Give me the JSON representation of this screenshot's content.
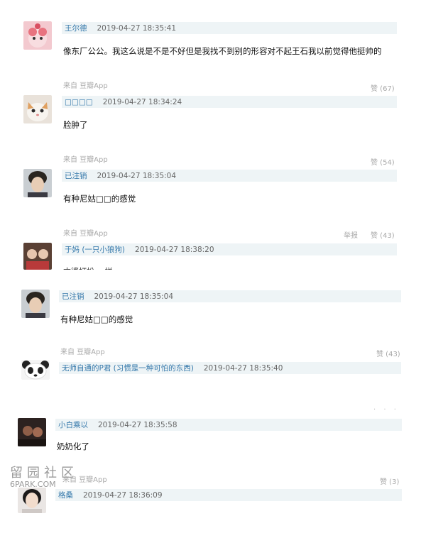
{
  "comments": [
    {
      "user": "王尔德",
      "time": "2019-04-27 18:35:41",
      "text": "像东厂公公。我这么说是不是不好但是我找不到别的形容对不起王石我以前觉得他挺帅的",
      "source": "来自 豆瓣App",
      "like": "赞 (67)"
    },
    {
      "user": "□□□□",
      "time": "2019-04-27 18:34:24",
      "text": "脸肿了",
      "source": "来自 豆瓣App",
      "like": "赞 (54)"
    },
    {
      "user": "已注销",
      "time": "2019-04-27 18:35:04",
      "text": "有种尼姑□□的感觉",
      "source": "来自 豆瓣App",
      "report": "举报",
      "like": "赞 (43)"
    },
    {
      "user": "于妈 (一只小狼狗)",
      "time": "2019-04-27 18:38:20",
      "text": "本婆打扮 一样"
    },
    {
      "user": "已注销",
      "time": "2019-04-27 18:35:04",
      "text": "有种尼姑□□的感觉",
      "source": "来自 豆瓣App",
      "like": "赞 (43)"
    },
    {
      "user": "无师自通的P君 (习惯是一种可怕的东西)",
      "time": "2019-04-27 18:35:40"
    },
    {
      "user": "小白乘以",
      "time": "2019-04-27 18:35:58",
      "text": "奶奶化了",
      "source": "来自 豆瓣App",
      "like": "赞 (3)"
    },
    {
      "user": "格桑",
      "time": "2019-04-27 18:36:09"
    }
  ],
  "watermark": {
    "line1": "留园社区",
    "line2": "6PARK.COM"
  },
  "icons": [
    "avatar-pink-cartoon",
    "avatar-cat",
    "avatar-boy",
    "avatar-couple",
    "avatar-boy",
    "avatar-panda",
    "avatar-dark",
    "avatar-girl"
  ]
}
